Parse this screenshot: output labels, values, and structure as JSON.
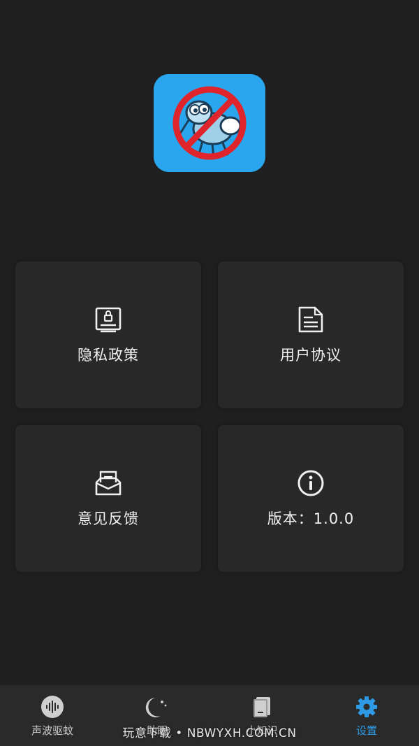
{
  "cards": [
    {
      "label": "隐私政策",
      "icon": "privacy-lock-icon"
    },
    {
      "label": "用户协议",
      "icon": "document-icon"
    },
    {
      "label": "意见反馈",
      "icon": "feedback-mail-icon"
    },
    {
      "label": "版本：1.0.0",
      "icon": "info-icon"
    }
  ],
  "tabs": [
    {
      "label": "声波驱蚊",
      "icon": "sound-wave-icon",
      "active": false
    },
    {
      "label": "助眠",
      "icon": "moon-icon",
      "active": false
    },
    {
      "label": "小知识",
      "icon": "book-icon",
      "active": false
    },
    {
      "label": "设置",
      "icon": "gear-icon",
      "active": true
    }
  ],
  "watermark": "玩意下载 • NBWYXH.COM.CN",
  "colors": {
    "background": "#1f1f1f",
    "card": "#282828",
    "accent": "#2e9ae6",
    "app_icon_bg": "#2aa6ee",
    "forbidden_red": "#e0242b"
  }
}
